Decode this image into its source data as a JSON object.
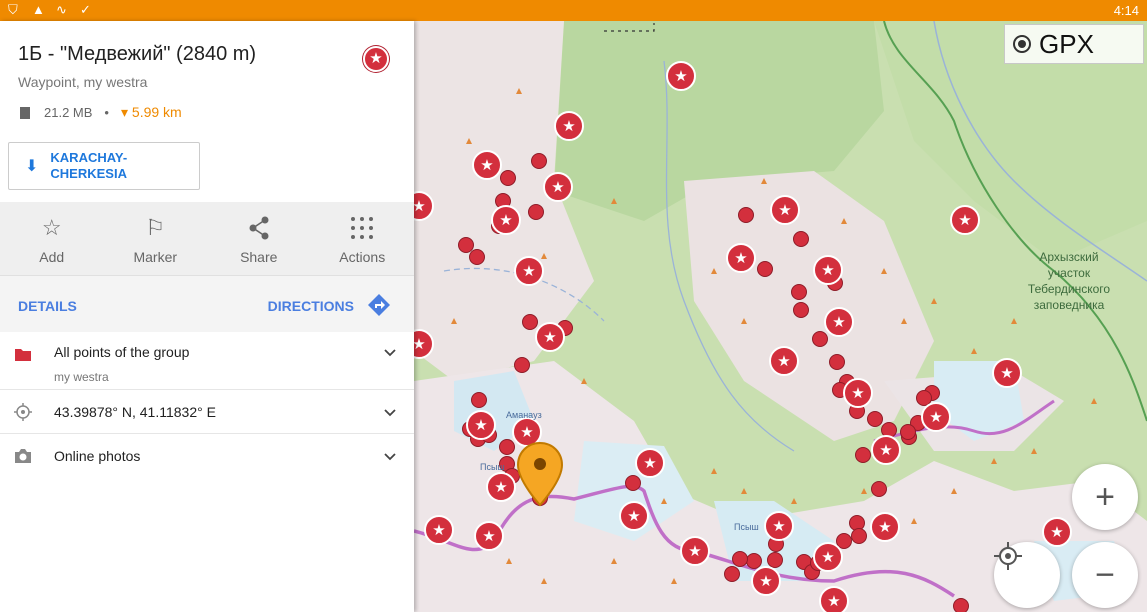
{
  "status_bar": {
    "time": "4:14",
    "icons": [
      "shield-icon",
      "warning-icon",
      "wave-icon",
      "check-icon"
    ]
  },
  "point": {
    "title": "1Б - \"Медвежий\" (2840 m)",
    "subtitle": "Waypoint, my westra",
    "storage": "21.2 MB",
    "separator": "•",
    "distance": "▾ 5.99 km"
  },
  "download": {
    "label": "KARACHAY-\nCHERKESIA",
    "icon": "download-icon"
  },
  "actions": [
    {
      "label": "Add",
      "icon": "star-icon"
    },
    {
      "label": "Marker",
      "icon": "flag-icon"
    },
    {
      "label": "Share",
      "icon": "share-icon"
    },
    {
      "label": "Actions",
      "icon": "grid-icon"
    }
  ],
  "nav": {
    "details": "DETAILS",
    "directions": "DIRECTIONS"
  },
  "rows": [
    {
      "main": "All points of the group",
      "sub": "my westra",
      "icon": "folder-icon"
    },
    {
      "main": "43.39878° N, 41.11832° E",
      "icon": "location-icon"
    },
    {
      "main": "Online photos",
      "icon": "camera-icon"
    }
  ],
  "map": {
    "overlay_button": "GPX",
    "label": "Архызский\nучасток\nТебердинского\nзаповедника",
    "small_labels": [
      "Аманауз",
      "Псыш",
      "Псыш"
    ]
  },
  "colors": {
    "accent": "#ef8a00",
    "link": "#4a7ee0",
    "marker": "#d32f3d",
    "route": "#c070c8"
  }
}
